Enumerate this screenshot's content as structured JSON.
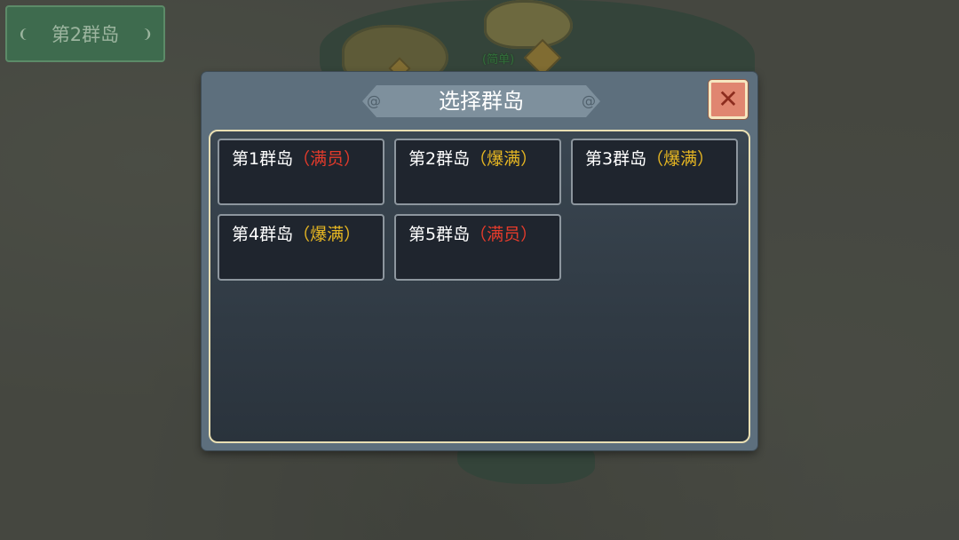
{
  "hud": {
    "current_island": "第2群岛"
  },
  "map": {
    "difficulty_label": "(简单)"
  },
  "dialog": {
    "title": "选择群岛",
    "close_icon": "close-x",
    "islands": [
      {
        "name": "第1群岛",
        "status": "（满员）",
        "status_color": "#e53b2b"
      },
      {
        "name": "第2群岛",
        "status": "（爆满）",
        "status_color": "#e6b622"
      },
      {
        "name": "第3群岛",
        "status": "（爆满）",
        "status_color": "#e6b622"
      },
      {
        "name": "第4群岛",
        "status": "（爆满）",
        "status_color": "#e6b622"
      },
      {
        "name": "第5群岛",
        "status": "（满员）",
        "status_color": "#e53b2b"
      }
    ]
  },
  "colors": {
    "full": "#e53b2b",
    "busy": "#e6b622",
    "close_button": "#e08670"
  }
}
